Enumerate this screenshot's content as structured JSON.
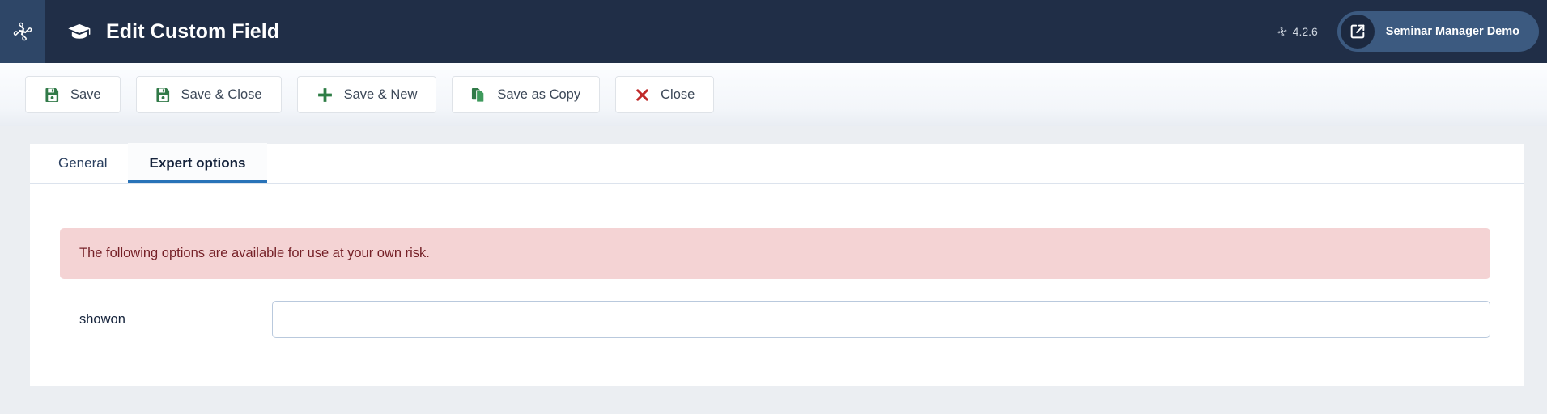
{
  "header": {
    "logo_icon": "joomla-logo-icon",
    "title_icon": "graduation-cap-icon",
    "title": "Edit Custom Field",
    "version_icon": "joomla-mini-icon",
    "version": "4.2.6",
    "demo_button": {
      "icon": "external-link-icon",
      "label": "Seminar Manager Demo"
    }
  },
  "toolbar": {
    "buttons": [
      {
        "label": "Save",
        "icon": "floppy-disk-icon",
        "icon_color": "#317a48"
      },
      {
        "label": "Save & Close",
        "icon": "floppy-disk-icon",
        "icon_color": "#317a48"
      },
      {
        "label": "Save & New",
        "icon": "plus-icon",
        "icon_color": "#2e7d46"
      },
      {
        "label": "Save as Copy",
        "icon": "copy-icon",
        "icon_color": "#317a48"
      },
      {
        "label": "Close",
        "icon": "cross-icon",
        "icon_color": "#c02a2a"
      }
    ]
  },
  "tabs": [
    {
      "label": "General",
      "active": false
    },
    {
      "label": "Expert options",
      "active": true
    }
  ],
  "alert": {
    "text": "The following options are available for use at your own risk.",
    "bg_color": "#f4d3d4",
    "text_color": "#752027"
  },
  "form": {
    "fields": [
      {
        "label": "showon",
        "value": "",
        "placeholder": ""
      }
    ]
  },
  "colors": {
    "header_bg": "#202e47",
    "logo_panel_bg": "#2e4667",
    "page_bg": "#ebeef2",
    "accent_blue": "#2973b8",
    "pill_bg": "#3c5a80"
  }
}
